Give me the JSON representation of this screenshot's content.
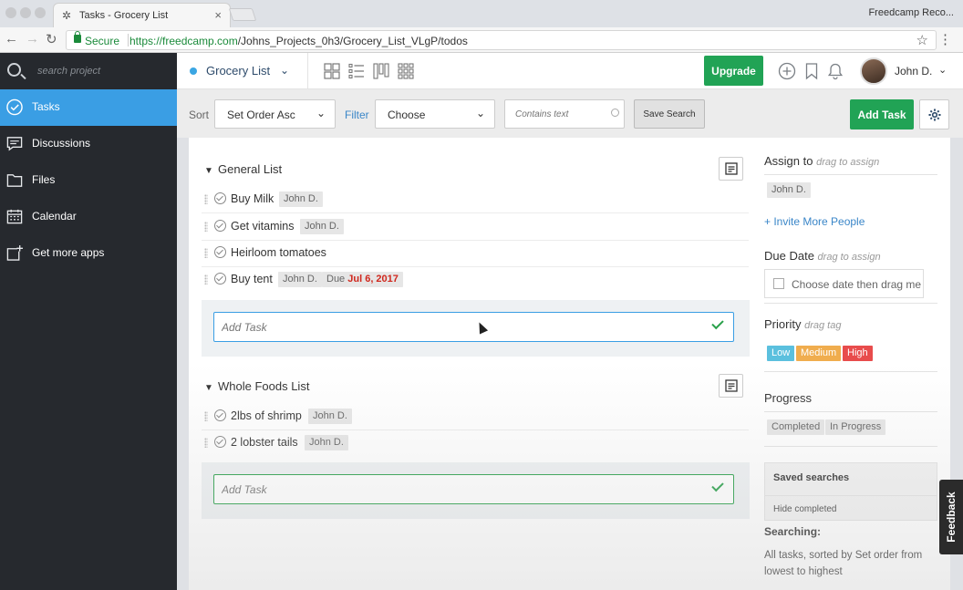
{
  "browser": {
    "tab_title": "Tasks - Grocery List",
    "profile_label": "Freedcamp Reco...",
    "secure_label": "Secure",
    "url_host": "https://freedcamp.com",
    "url_path": "/Johns_Projects_0h3/Grocery_List_VLgP/todos"
  },
  "sidebar": {
    "search_placeholder": "search project",
    "items": [
      {
        "label": "Tasks",
        "icon": "check-circle-icon",
        "active": true
      },
      {
        "label": "Discussions",
        "icon": "chat-icon"
      },
      {
        "label": "Files",
        "icon": "folder-icon"
      },
      {
        "label": "Calendar",
        "icon": "calendar-icon"
      },
      {
        "label": "Get more apps",
        "icon": "add-app-icon"
      }
    ]
  },
  "header": {
    "project_name": "Grocery List",
    "upgrade_label": "Upgrade",
    "user_name": "John D."
  },
  "toolbar": {
    "sort_label": "Sort",
    "sort_value": "Set Order Asc",
    "filter_label": "Filter",
    "filter_value": "Choose",
    "search_placeholder": "Contains text",
    "save_search_label": "Save Search",
    "add_task_label": "Add Task"
  },
  "lists": [
    {
      "name": "General List",
      "add_placeholder": "Add Task",
      "tasks": [
        {
          "name": "Buy Milk",
          "assignee": "John D."
        },
        {
          "name": "Get vitamins",
          "assignee": "John D."
        },
        {
          "name": "Heirloom tomatoes"
        },
        {
          "name": "Buy tent",
          "assignee": "John D.",
          "due_prefix": "Due",
          "due_date": "Jul 6, 2017"
        }
      ]
    },
    {
      "name": "Whole Foods List",
      "add_placeholder": "Add Task",
      "tasks": [
        {
          "name": "2lbs of shrimp",
          "assignee": "John D."
        },
        {
          "name": "2 lobster tails",
          "assignee": "John D."
        }
      ]
    }
  ],
  "panel": {
    "assign_title": "Assign to",
    "assign_hint": "drag to assign",
    "assign_user": "John D.",
    "invite_link": "+ Invite More People",
    "due_title": "Due Date",
    "due_hint": "drag to assign",
    "due_placeholder": "Choose date then drag me",
    "priority_title": "Priority",
    "priority_hint": "drag tag",
    "priorities": [
      {
        "label": "Low",
        "color": "#5bc0de"
      },
      {
        "label": "Medium",
        "color": "#f0ad4e"
      },
      {
        "label": "High",
        "color": "#e84c4c"
      }
    ],
    "progress_title": "Progress",
    "progress_tags": [
      "Completed",
      "In Progress"
    ],
    "saved_title": "Saved searches",
    "saved_item": "Hide completed",
    "searching_title": "Searching:",
    "searching_text": "All tasks, sorted by Set order from lowest to highest"
  },
  "feedback_label": "Feedback",
  "colors": {
    "accent_green": "#21a355",
    "sidebar_active": "#3a9ee4",
    "sidebar_bg": "#26292e",
    "due_red": "#d0271d"
  }
}
